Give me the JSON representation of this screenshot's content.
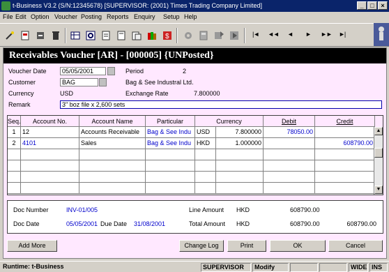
{
  "window": {
    "title": "t-Business V3.2 (S/N:12345678) [SUPERVISOR: (2001) Times Trading Company Limited]",
    "minimize": "_",
    "maximize": "□",
    "close": "×"
  },
  "menu": [
    "File",
    "Edit",
    "Option",
    "Voucher",
    "Posting",
    "Reports",
    "Enquiry",
    "Setup",
    "Help"
  ],
  "toolbar": {
    "nav_first": "|◄",
    "nav_prev_page": "◄◄",
    "nav_prev": "◄",
    "nav_next": "►",
    "nav_next_page": "►►",
    "nav_last": "►|"
  },
  "voucher": {
    "title": "Receivables Voucher [AR] - [000005] {UNPosted}",
    "date_label": "Voucher Date",
    "date_value": "05/05/2001",
    "period_label": "Period",
    "period_value": "2",
    "customer_label": "Customer",
    "customer_code": "BAG",
    "customer_name": "Bag & See Industral Ltd.",
    "currency_label": "Currency",
    "currency_value": "USD",
    "rate_label": "Exchange Rate",
    "rate_value": "7.800000",
    "remark_label": "Remark",
    "remark_value": "3\" boz file x 2,600 sets"
  },
  "grid": {
    "headers": {
      "seq": "Seq.",
      "account_no": "Account No.",
      "account_name": "Account Name",
      "particular": "Particular",
      "currency": "Currency",
      "debit": "Debit",
      "credit": "Credit"
    },
    "rows": [
      {
        "seq": "1",
        "account_no": "12",
        "account_name": "Accounts Receivable",
        "particular": "Bag & See Indu",
        "currency": "USD",
        "rate": "7.800000",
        "debit": "78050.00",
        "credit": ""
      },
      {
        "seq": "2",
        "account_no": "4101",
        "account_name": "Sales",
        "particular": "Bag & See Indu",
        "currency": "HKD",
        "rate": "1.000000",
        "debit": "",
        "credit": "608790.00"
      }
    ]
  },
  "summary": {
    "doc_number_label": "Doc Number",
    "doc_number": "INV-01/005",
    "doc_date_label": "Doc Date",
    "doc_date": "05/05/2001",
    "due_date_label": "Due Date",
    "due_date": "31/08/2001",
    "line_amount_label": "Line Amount",
    "line_amount_currency": "HKD",
    "line_amount": "608790.00",
    "total_amount_label": "Total Amount",
    "total_amount_currency": "HKD",
    "total_amount_debit": "608790.00",
    "total_amount_credit": "608790.00"
  },
  "buttons": {
    "add_more": "Add More",
    "change_log": "Change Log",
    "print": "Print",
    "ok": "OK",
    "cancel": "Cancel"
  },
  "status": {
    "runtime": "Runtime: t-Business",
    "user": "SUPERVISOR",
    "mode": "Modify",
    "wide": "WIDE",
    "ins": "INS"
  }
}
